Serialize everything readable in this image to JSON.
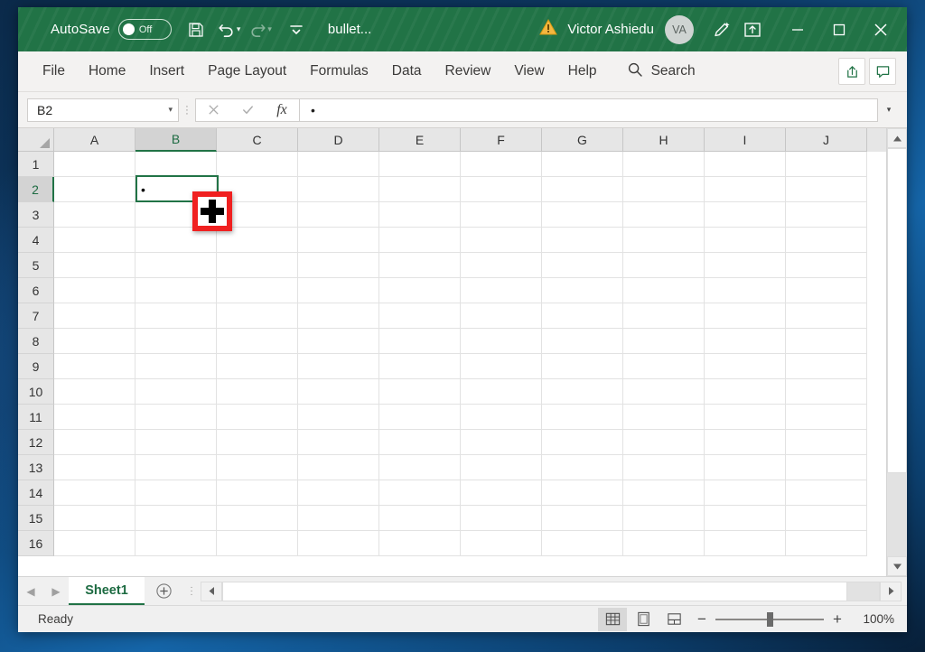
{
  "titlebar": {
    "autosave_label": "AutoSave",
    "autosave_state": "Off",
    "save_icon": "save-icon",
    "undo_icon": "undo-icon",
    "redo_icon": "redo-icon",
    "customize_qat_icon": "customize-quick-access-toolbar-icon",
    "document_name": "bullet...",
    "warning_icon": "warning-triangle-icon",
    "user_name": "Victor Ashiedu",
    "user_initials": "VA",
    "ink_icon": "pen-ink-icon",
    "ribbon_display_icon": "ribbon-display-options-icon",
    "minimize_label": "—",
    "maximize_label": "□",
    "close_label": "✕",
    "bg_color": "#217346"
  },
  "ribbon": {
    "tabs": [
      {
        "label": "File"
      },
      {
        "label": "Home"
      },
      {
        "label": "Insert"
      },
      {
        "label": "Page Layout"
      },
      {
        "label": "Formulas"
      },
      {
        "label": "Data"
      },
      {
        "label": "Review"
      },
      {
        "label": "View"
      },
      {
        "label": "Help"
      }
    ],
    "search_label": "Search",
    "search_icon": "search-icon",
    "share_icon": "share-icon",
    "comments_icon": "comments-icon"
  },
  "formulabar": {
    "name_box_value": "B2",
    "cancel_icon": "cancel-icon",
    "enter_icon": "enter-checkmark-icon",
    "function_icon": "fx",
    "formula_value": "•",
    "expand_icon": "expand-formula-bar-icon"
  },
  "grid": {
    "columns": [
      "A",
      "B",
      "C",
      "D",
      "E",
      "F",
      "G",
      "H",
      "I",
      "J"
    ],
    "rows": [
      "1",
      "2",
      "3",
      "4",
      "5",
      "6",
      "7",
      "8",
      "9",
      "10",
      "11",
      "12",
      "13",
      "14",
      "15",
      "16"
    ],
    "selected_column": "B",
    "selected_row": "2",
    "selected_cell": "B2",
    "cell_values": {
      "B2": "•"
    },
    "selection_color": "#217346",
    "cursor": {
      "icon": "plus-crosshair-cursor",
      "highlight_color": "#f02020"
    }
  },
  "sheettabs": {
    "prev_icon": "previous-sheet-icon",
    "next_icon": "next-sheet-icon",
    "sheets": [
      {
        "label": "Sheet1",
        "active": true
      }
    ],
    "add_sheet_icon": "add-sheet-plus-icon"
  },
  "statusbar": {
    "status_text": "Ready",
    "normal_view_icon": "normal-view-icon",
    "page_layout_icon": "page-layout-view-icon",
    "page_break_icon": "page-break-preview-icon",
    "zoom_out_label": "−",
    "zoom_in_label": "+",
    "zoom_level": "100%"
  }
}
